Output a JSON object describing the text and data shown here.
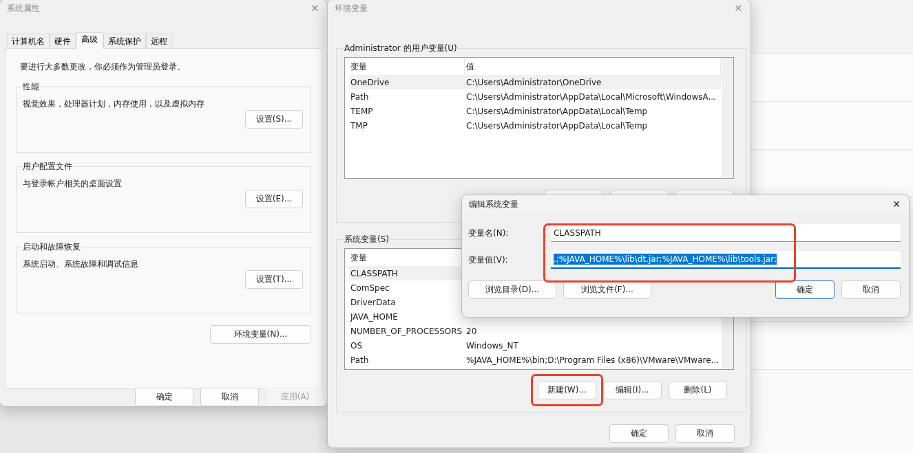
{
  "system_properties": {
    "title": "系统属性",
    "close": "✕",
    "tabs": [
      {
        "label": "计算机名",
        "selected": false
      },
      {
        "label": "硬件",
        "selected": false
      },
      {
        "label": "高级",
        "selected": true
      },
      {
        "label": "系统保护",
        "selected": false
      },
      {
        "label": "远程",
        "selected": false
      }
    ],
    "notice": "要进行大多数更改，你必须作为管理员登录。",
    "groups": [
      {
        "title": "性能",
        "description": "视觉效果，处理器计划，内存使用，以及虚拟内存",
        "button": "设置(S)..."
      },
      {
        "title": "用户配置文件",
        "description": "与登录帐户相关的桌面设置",
        "button": "设置(E)..."
      },
      {
        "title": "启动和故障恢复",
        "description": "系统启动、系统故障和调试信息",
        "button": "设置(T)..."
      }
    ],
    "env_button": "环境变量(N)...",
    "buttons": [
      {
        "label": "确定",
        "disabled": false
      },
      {
        "label": "取消",
        "disabled": false
      },
      {
        "label": "应用(A)",
        "disabled": true
      }
    ]
  },
  "environment_variables": {
    "title": "环境变量",
    "close": "✕",
    "user_group": {
      "title": "Administrator 的用户变量(U)",
      "columns": [
        "变量",
        "值"
      ],
      "rows": [
        {
          "name": "OneDrive",
          "value": "C:\\Users\\Administrator\\OneDrive",
          "selected": true
        },
        {
          "name": "Path",
          "value": "C:\\Users\\Administrator\\AppData\\Local\\Microsoft\\WindowsA...",
          "selected": false
        },
        {
          "name": "TEMP",
          "value": "C:\\Users\\Administrator\\AppData\\Local\\Temp",
          "selected": false
        },
        {
          "name": "TMP",
          "value": "C:\\Users\\Administrator\\AppData\\Local\\Temp",
          "selected": false
        }
      ]
    },
    "system_group": {
      "title": "系统变量(S)",
      "columns": [
        "变量"
      ],
      "rows": [
        {
          "name": "CLASSPATH",
          "selected": true
        },
        {
          "name": "ComSpec",
          "selected": false
        },
        {
          "name": "DriverData",
          "selected": false
        },
        {
          "name": "JAVA_HOME",
          "selected": false
        },
        {
          "name": "NUMBER_OF_PROCESSORS",
          "value": "20",
          "selected": false
        },
        {
          "name": "OS",
          "value": "Windows_NT",
          "selected": false
        },
        {
          "name": "Path",
          "value": "%JAVA_HOME%\\bin;D:\\Program Files (x86)\\VMware\\VMware...",
          "selected": false
        }
      ],
      "buttons": [
        {
          "label": "新建(W)...",
          "highlighted": true
        },
        {
          "label": "编辑(I)...",
          "highlighted": false
        },
        {
          "label": "删除(L)",
          "highlighted": false
        }
      ]
    },
    "buttons": [
      "确定",
      "取消"
    ]
  },
  "edit_dialog": {
    "title": "编辑系统变量",
    "close": "✕",
    "highlighted": true,
    "fields": [
      {
        "label": "变量名(N):",
        "value": "CLASSPATH",
        "focused": false
      },
      {
        "label": "变量值(V):",
        "value": ".;%JAVA_HOME%\\lib\\dt.jar;%JAVA_HOME%\\lib\\tools.jar;",
        "focused": true
      }
    ],
    "browse_buttons": [
      "浏览目录(D)...",
      "浏览文件(F)..."
    ],
    "buttons": [
      {
        "label": "确定",
        "default": true
      },
      {
        "label": "取消",
        "default": false
      }
    ]
  }
}
